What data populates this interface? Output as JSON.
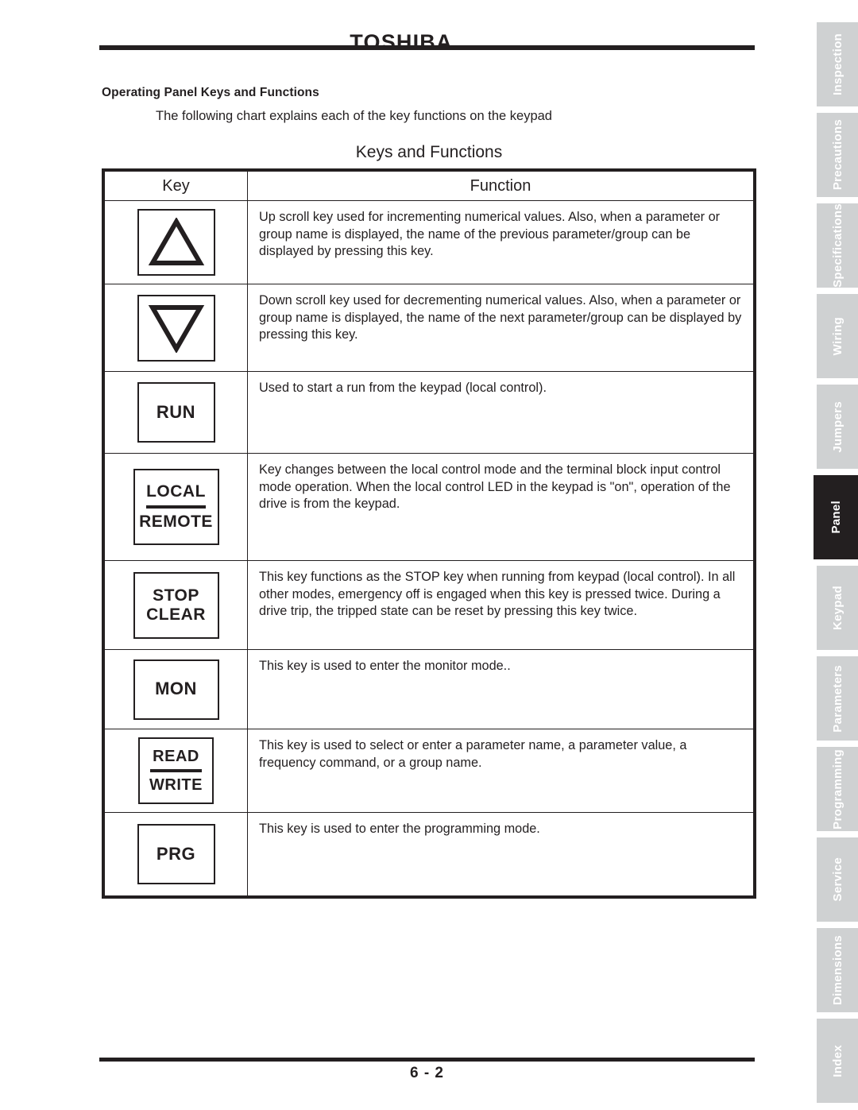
{
  "header": {
    "brand": "TOSHIBA"
  },
  "section": {
    "heading": "Operating Panel Keys and Functions",
    "intro": "The following chart explains each of the key functions on the keypad"
  },
  "table": {
    "title": "Keys and Functions",
    "columns": {
      "key": "Key",
      "function": "Function"
    },
    "rows": [
      {
        "key_type": "triangle-up",
        "key_labels": [],
        "function": "Up scroll key used for incrementing numerical values. Also, when a parameter or group name is displayed, the name of the previous parameter/group can be displayed by pressing this key."
      },
      {
        "key_type": "triangle-down",
        "key_labels": [],
        "function": "Down scroll key used for decrementing numerical values. Also, when a parameter or group name is displayed, the name of the next parameter/group can be displayed by pressing this key."
      },
      {
        "key_type": "text",
        "key_labels": [
          "RUN"
        ],
        "divider": false,
        "function": "Used to start a run from the keypad (local control)."
      },
      {
        "key_type": "text",
        "key_labels": [
          "LOCAL",
          "REMOTE"
        ],
        "divider": true,
        "function": "Key changes between the local control mode and the terminal block input control mode operation. When the local control LED in the keypad is \"on\", operation of the drive is from the keypad."
      },
      {
        "key_type": "text",
        "key_labels": [
          "STOP",
          "CLEAR"
        ],
        "divider": false,
        "function": "This key functions as the STOP key when running from keypad (local control). In all other modes, emergency off is engaged when this key is pressed twice. During a drive trip, the tripped state can be reset by pressing this key twice."
      },
      {
        "key_type": "text",
        "key_labels": [
          "MON"
        ],
        "divider": false,
        "function": "This key is used to enter the monitor mode.."
      },
      {
        "key_type": "text",
        "key_labels": [
          "READ",
          "WRITE"
        ],
        "divider": true,
        "function": "This key is used to select or enter a parameter name, a parameter value, a frequency command, or a group name."
      },
      {
        "key_type": "text",
        "key_labels": [
          "PRG"
        ],
        "divider": false,
        "function": "This key is used to enter the programming mode."
      }
    ]
  },
  "footer": {
    "page_number": "6 - 2"
  },
  "sidebar": {
    "active_tab": "Panel",
    "colors": {
      "inactive_background": "#cfd1d2",
      "active_background": "#231f20",
      "label": "#ffffff"
    },
    "tabs": [
      {
        "label": "Inspection"
      },
      {
        "label": "Precautions"
      },
      {
        "label": "Specifications"
      },
      {
        "label": "Wiring"
      },
      {
        "label": "Jumpers"
      },
      {
        "label": "Panel"
      },
      {
        "label": "Keypad"
      },
      {
        "label": "Parameters"
      },
      {
        "label": "Programming"
      },
      {
        "label": "Service"
      },
      {
        "label": "Dimensions"
      },
      {
        "label": "Index"
      }
    ]
  }
}
